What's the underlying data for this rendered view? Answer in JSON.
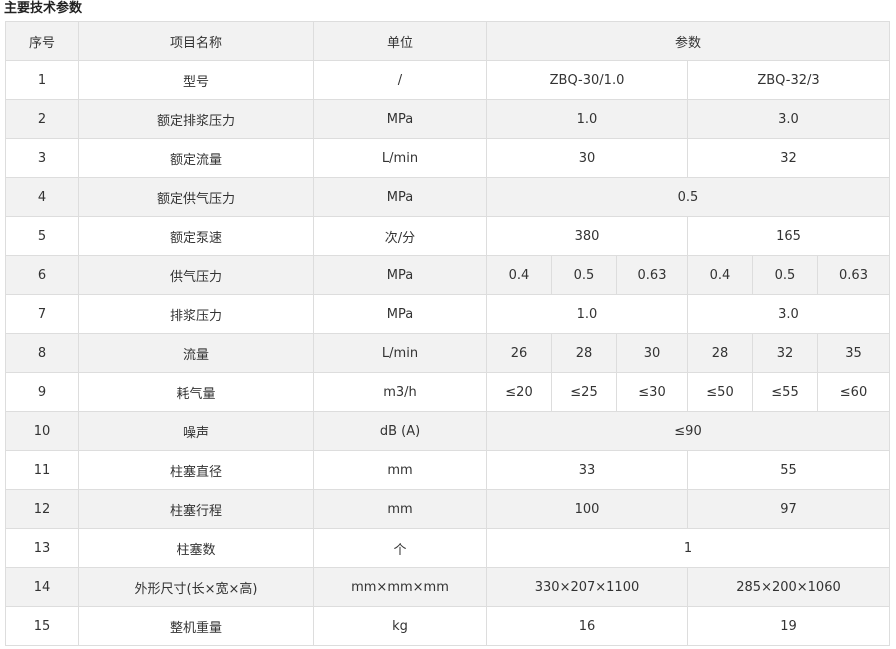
{
  "title": "主要技术参数",
  "header": {
    "no": "序号",
    "name": "项目名称",
    "unit": "单位",
    "params": "参数"
  },
  "rows": [
    {
      "no": "1",
      "name": "型号",
      "unit": "/",
      "cells": [
        {
          "text": "ZBQ-30/1.0",
          "span": 3
        },
        {
          "text": "ZBQ-32/3",
          "span": 3
        }
      ]
    },
    {
      "no": "2",
      "name": "额定排浆压力",
      "unit": "MPa",
      "cells": [
        {
          "text": "1.0",
          "span": 3
        },
        {
          "text": "3.0",
          "span": 3
        }
      ]
    },
    {
      "no": "3",
      "name": "额定流量",
      "unit": "L/min",
      "cells": [
        {
          "text": "30",
          "span": 3
        },
        {
          "text": "32",
          "span": 3
        }
      ]
    },
    {
      "no": "4",
      "name": "额定供气压力",
      "unit": "MPa",
      "cells": [
        {
          "text": "0.5",
          "span": 6
        }
      ]
    },
    {
      "no": "5",
      "name": "额定泵速",
      "unit": "次/分",
      "cells": [
        {
          "text": "380",
          "span": 3
        },
        {
          "text": "165",
          "span": 3
        }
      ]
    },
    {
      "no": "6",
      "name": "供气压力",
      "unit": "MPa",
      "cells": [
        {
          "text": "0.4",
          "span": 1
        },
        {
          "text": "0.5",
          "span": 1
        },
        {
          "text": "0.63",
          "span": 1
        },
        {
          "text": "0.4",
          "span": 1
        },
        {
          "text": "0.5",
          "span": 1
        },
        {
          "text": "0.63",
          "span": 1
        }
      ]
    },
    {
      "no": "7",
      "name": "排浆压力",
      "unit": "MPa",
      "cells": [
        {
          "text": "1.0",
          "span": 3
        },
        {
          "text": "3.0",
          "span": 3
        }
      ]
    },
    {
      "no": "8",
      "name": "流量",
      "unit": "L/min",
      "cells": [
        {
          "text": "26",
          "span": 1
        },
        {
          "text": "28",
          "span": 1
        },
        {
          "text": "30",
          "span": 1
        },
        {
          "text": "28",
          "span": 1
        },
        {
          "text": "32",
          "span": 1
        },
        {
          "text": "35",
          "span": 1
        }
      ]
    },
    {
      "no": "9",
      "name": "耗气量",
      "unit": "m3/h",
      "cells": [
        {
          "text": "≤20",
          "span": 1
        },
        {
          "text": "≤25",
          "span": 1
        },
        {
          "text": "≤30",
          "span": 1
        },
        {
          "text": "≤50",
          "span": 1
        },
        {
          "text": "≤55",
          "span": 1
        },
        {
          "text": "≤60",
          "span": 1
        }
      ]
    },
    {
      "no": "10",
      "name": "噪声",
      "unit": "dB (A)",
      "cells": [
        {
          "text": "≤90",
          "span": 6
        }
      ]
    },
    {
      "no": "11",
      "name": "柱塞直径",
      "unit": "mm",
      "cells": [
        {
          "text": "33",
          "span": 3
        },
        {
          "text": "55",
          "span": 3
        }
      ]
    },
    {
      "no": "12",
      "name": "柱塞行程",
      "unit": "mm",
      "cells": [
        {
          "text": "100",
          "span": 3
        },
        {
          "text": "97",
          "span": 3
        }
      ]
    },
    {
      "no": "13",
      "name": "柱塞数",
      "unit": "个",
      "cells": [
        {
          "text": "1",
          "span": 6
        }
      ]
    },
    {
      "no": "14",
      "name": "外形尺寸(长×宽×高)",
      "unit": "mm×mm×mm",
      "cells": [
        {
          "text": "330×207×1100",
          "span": 3
        },
        {
          "text": "285×200×1060",
          "span": 3
        }
      ]
    },
    {
      "no": "15",
      "name": "整机重量",
      "unit": "kg",
      "cells": [
        {
          "text": "16",
          "span": 3
        },
        {
          "text": "19",
          "span": 3
        }
      ]
    }
  ]
}
